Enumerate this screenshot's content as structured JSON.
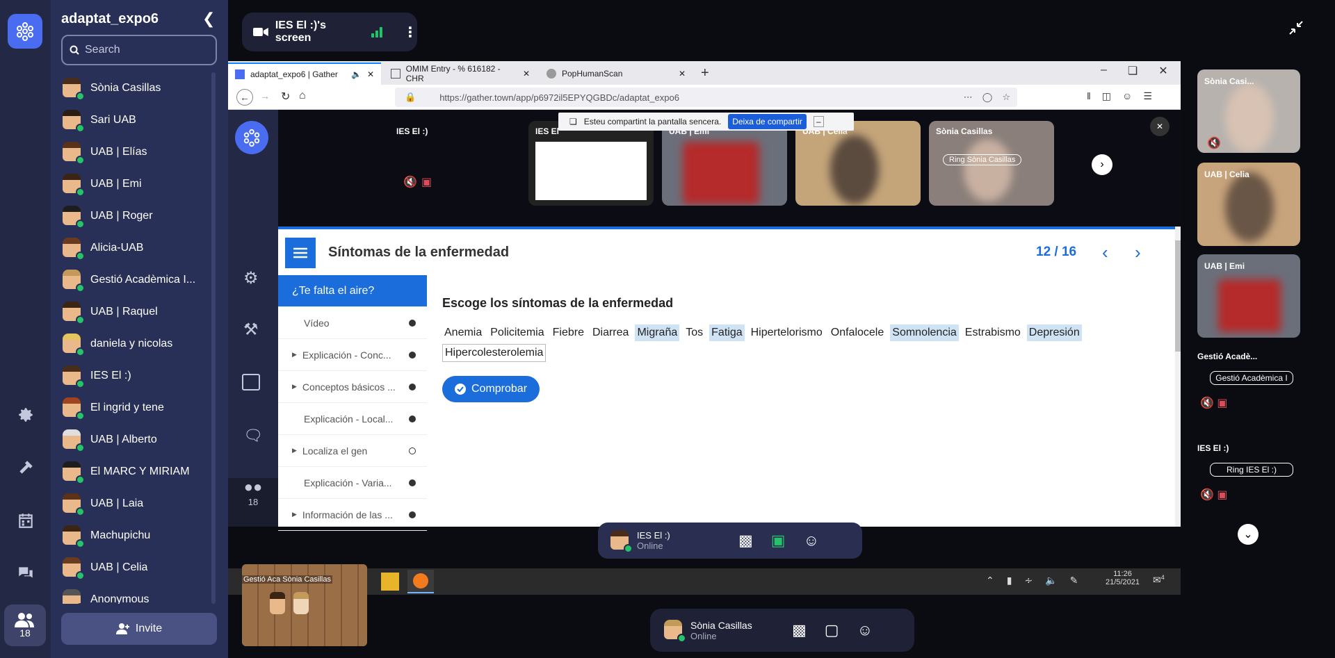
{
  "sidebar": {
    "space_name": "adaptat_expo6",
    "search_placeholder": "Search",
    "online_count": "18",
    "invite_label": "Invite",
    "people": [
      "Sònia Casillas",
      "Sari UAB",
      "UAB | Elías",
      "UAB | Emi",
      "UAB | Roger",
      "Alicia-UAB",
      "Gestió Acadèmica I...",
      "UAB | Raquel",
      "daniela y nicolas",
      "IES El :)",
      "El ingrid y tene",
      "UAB | Alberto",
      "El MARC Y MIRIAM",
      "UAB | Laia",
      "Machupichu",
      "UAB | Celia",
      "Anonymous"
    ]
  },
  "screenshare": {
    "label": "IES El :)'s screen"
  },
  "browser": {
    "tabs": [
      {
        "title": "adaptat_expo6 | Gather",
        "active": true
      },
      {
        "title": "OMIM Entry - % 616182 - CHR",
        "active": false
      },
      {
        "title": "PopHumanScan",
        "active": false
      }
    ],
    "url": "https://gather.town/app/p6972il5EPYQGBDc/adaptat_expo6",
    "share_notice": "Esteu compartint la pantalla sencera.",
    "share_stop": "Deixa de compartir"
  },
  "inner": {
    "online_count": "18",
    "tiles": [
      "IES El :)",
      "IES El",
      "UAB | Emi",
      "UAB | Celia",
      "Sònia Casillas"
    ],
    "ring_label": "Ring Sònia Casillas",
    "user_name": "IES El :)",
    "user_status": "Online"
  },
  "lesson": {
    "title": "Síntomas de la enfermedad",
    "pager": "12 / 16",
    "nav": [
      {
        "label": "¿Te falta el aire?",
        "selected": true,
        "arrow": false,
        "dot": ""
      },
      {
        "label": "Vídeo",
        "selected": false,
        "arrow": false,
        "dot": "filled"
      },
      {
        "label": "Explicación - Conc...",
        "selected": false,
        "arrow": true,
        "dot": "filled"
      },
      {
        "label": "Conceptos básicos ...",
        "selected": false,
        "arrow": true,
        "dot": "filled"
      },
      {
        "label": "Explicación - Local...",
        "selected": false,
        "arrow": false,
        "dot": "filled"
      },
      {
        "label": "Localiza el gen",
        "selected": false,
        "arrow": true,
        "dot": "empty"
      },
      {
        "label": "Explicación - Varia...",
        "selected": false,
        "arrow": false,
        "dot": "filled"
      },
      {
        "label": "Información de las ...",
        "selected": false,
        "arrow": true,
        "dot": "filled"
      }
    ],
    "question": "Escoge los síntomas de la enfermedad",
    "words": [
      {
        "t": "Anemia",
        "s": ""
      },
      {
        "t": "Policitemia",
        "s": ""
      },
      {
        "t": "Fiebre",
        "s": ""
      },
      {
        "t": "Diarrea",
        "s": ""
      },
      {
        "t": "Migraña",
        "s": "hl"
      },
      {
        "t": "Tos",
        "s": ""
      },
      {
        "t": "Fatiga",
        "s": "hl"
      },
      {
        "t": "Hipertelorismo",
        "s": ""
      },
      {
        "t": "Onfalocele",
        "s": ""
      },
      {
        "t": "Somnolencia",
        "s": "hl"
      },
      {
        "t": "Estrabismo",
        "s": ""
      },
      {
        "t": "Depresión",
        "s": "hl"
      },
      {
        "t": "Hipercolesterolemia",
        "s": "box"
      }
    ],
    "check_label": "Comprobar"
  },
  "taskbar": {
    "time": "11:26",
    "date": "21/5/2021",
    "notif": "4",
    "minimap_labels": "Gestió Aca Sònia Casillas"
  },
  "bottom": {
    "user_name": "Sònia Casillas",
    "user_status": "Online"
  },
  "right": {
    "tiles": [
      "Sònia Casi...",
      "UAB | Celia",
      "UAB | Emi"
    ],
    "cards": [
      {
        "name": "Gestió Acadè...",
        "ring": "Gestió Acadèmica I"
      },
      {
        "name": "IES El :)",
        "ring": "Ring IES El :)"
      }
    ]
  },
  "colors": {
    "accent": "#1a6ddb",
    "gather_blue": "#4a6cf0",
    "online": "#25c46b",
    "highlight": "#cfe3f5"
  }
}
